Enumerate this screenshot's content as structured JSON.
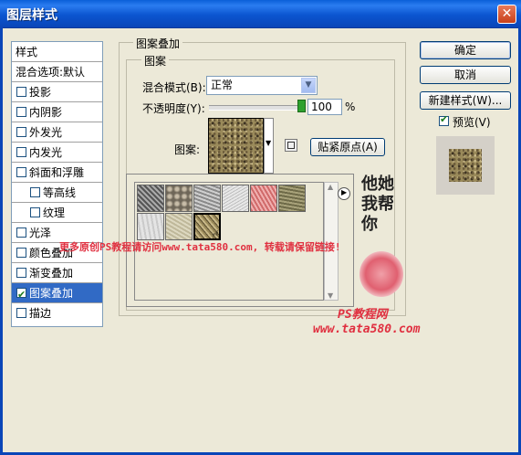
{
  "window": {
    "title": "图层样式",
    "close_glyph": "✕"
  },
  "left_list": {
    "header": "样式",
    "blend_options": "混合选项:默认",
    "items": [
      {
        "label": "投影",
        "checked": false
      },
      {
        "label": "内阴影",
        "checked": false
      },
      {
        "label": "外发光",
        "checked": false
      },
      {
        "label": "内发光",
        "checked": false
      },
      {
        "label": "斜面和浮雕",
        "checked": false
      },
      {
        "label": "等高线",
        "checked": false
      },
      {
        "label": "纹理",
        "checked": false
      },
      {
        "label": "光泽",
        "checked": false
      },
      {
        "label": "颜色叠加",
        "checked": false
      },
      {
        "label": "渐变叠加",
        "checked": false
      },
      {
        "label": "图案叠加",
        "checked": true
      },
      {
        "label": "描边",
        "checked": false
      }
    ]
  },
  "pattern_overlay": {
    "group_title": "图案叠加",
    "sub_title": "图案",
    "blend_mode_label": "混合模式(B):",
    "blend_mode_value": "正常",
    "opacity_label": "不透明度(Y):",
    "opacity_value": "100",
    "opacity_unit": "%",
    "opacity_level": 100,
    "pattern_label": "图案:",
    "snap_button": "贴紧原点(A)"
  },
  "buttons": {
    "ok": "确定",
    "cancel": "取消",
    "new_style": "新建样式(W)...",
    "preview": "预览(V)",
    "preview_checked": true
  },
  "watermark": {
    "line": "更多原创PS教程请访问www.tata580.com, 转载请保留链接!",
    "site_title": "PS教程网",
    "site_url": "www.tata580.com",
    "brush_text": "他她我帮你"
  },
  "colors": {
    "title_bar": "#0a5fd8",
    "selection": "#316ac5",
    "watermark": "#e03040"
  },
  "icons": {
    "close": "close-icon",
    "dropdown": "chevron-down-icon",
    "picker_menu": "triangle-right-icon",
    "new_preset": "new-preset-icon"
  }
}
